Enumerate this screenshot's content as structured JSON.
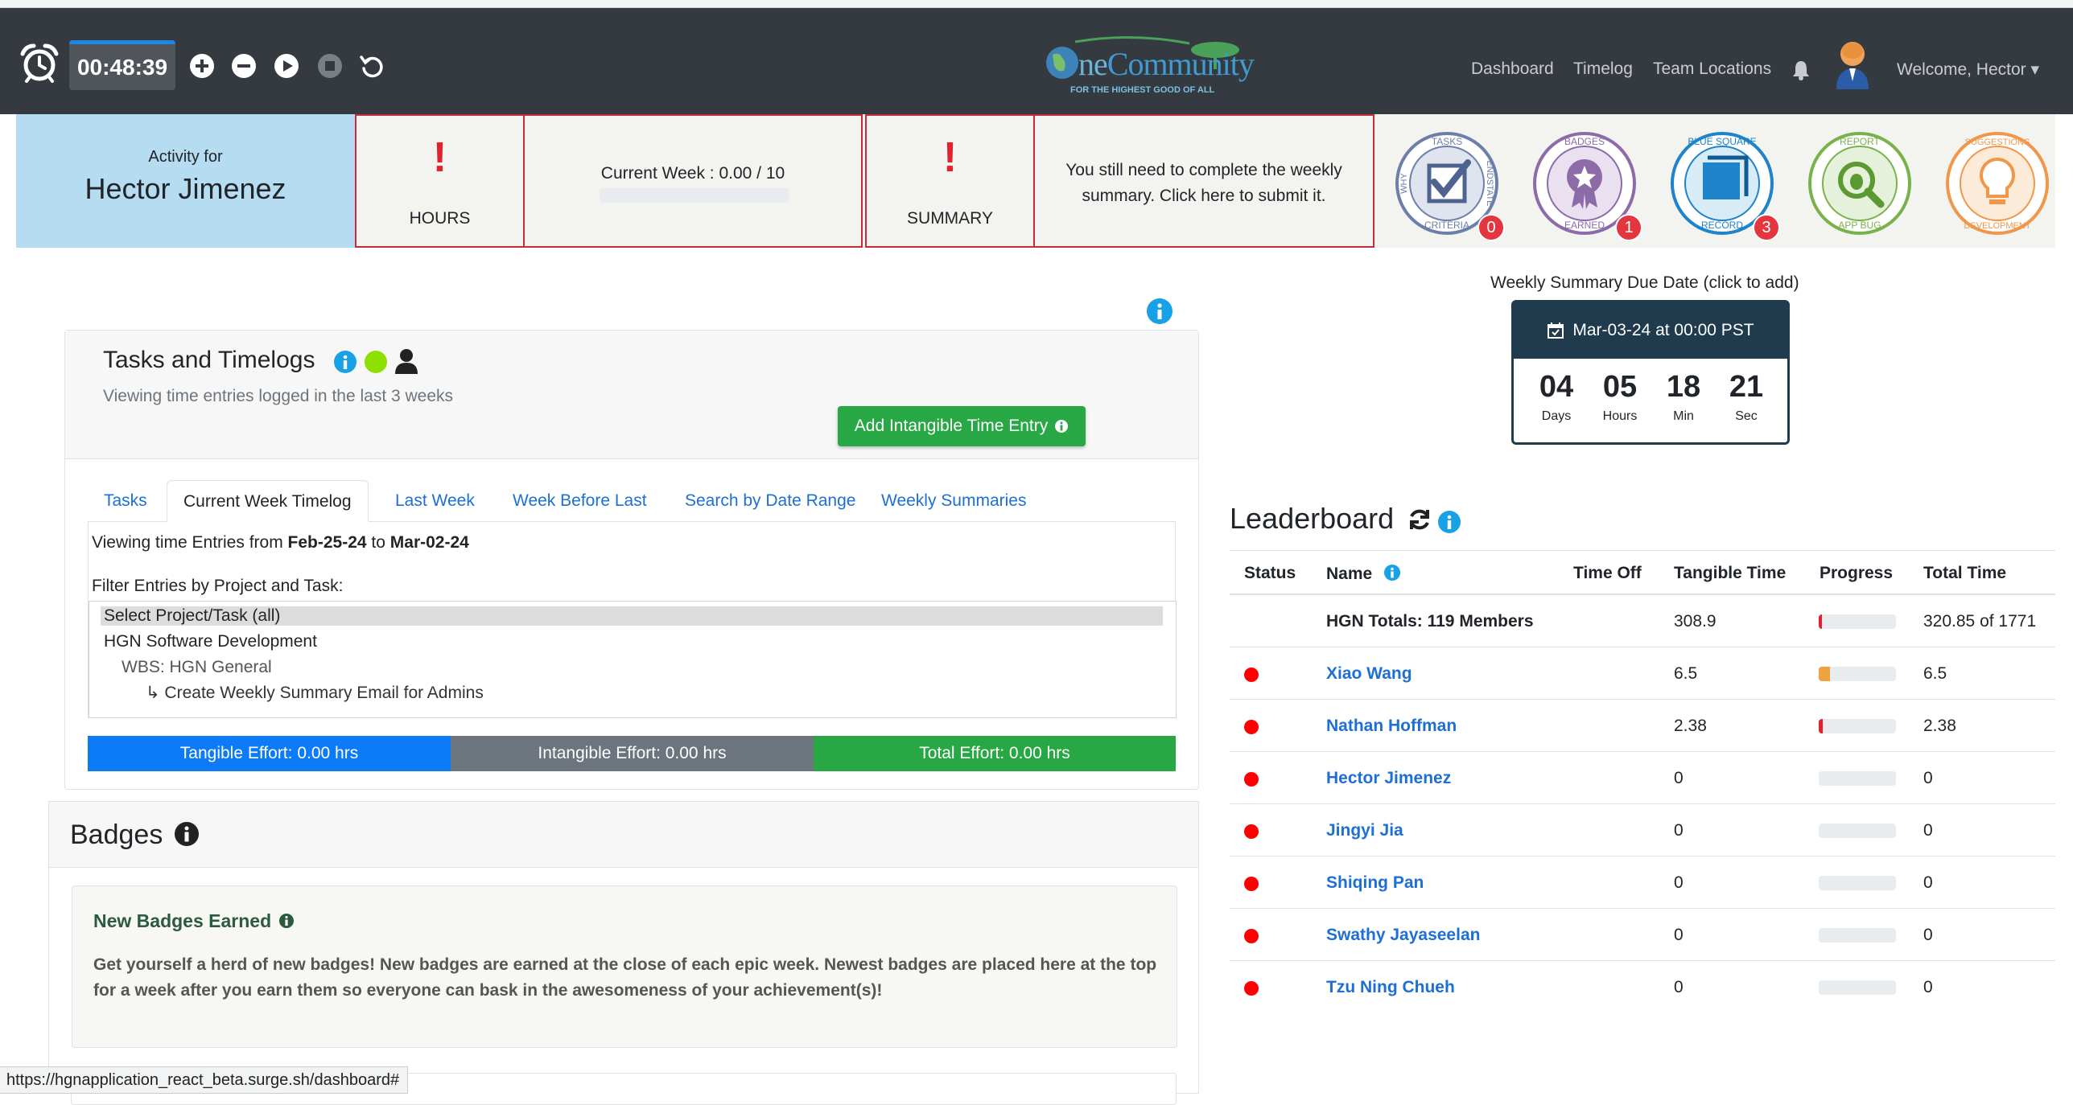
{
  "timer": {
    "display": "00:48:39"
  },
  "nav": {
    "links": [
      "Dashboard",
      "Timelog",
      "Team Locations"
    ],
    "welcome": "Welcome, Hector ▾"
  },
  "logo": {
    "text_main": "ne",
    "text_community": "Community",
    "tagline": "FOR THE HIGHEST GOOD OF ALL"
  },
  "summary": {
    "activity_label": "Activity for",
    "activity_name": "Hector Jimenez",
    "hours_label": "HOURS",
    "current_week": "Current Week : 0.00 / 10",
    "summary_label": "SUMMARY",
    "summary_text": "You still need to complete the weekly summary. Click here to submit it.",
    "bang": "!",
    "badges": [
      {
        "name": "tasks",
        "top": "TASKS",
        "bottom": "CRITERIA",
        "left": "WHY",
        "right": "ENDSTATE",
        "count": "0",
        "color": "#6c7fa8"
      },
      {
        "name": "badges",
        "top": "BADGES",
        "bottom": "EARNED",
        "count": "1",
        "color": "#8d6aa8"
      },
      {
        "name": "bluesquare",
        "top": "BLUE SQUARE",
        "bottom": "RECORD",
        "count": "3",
        "color": "#1f83c9"
      },
      {
        "name": "report",
        "top": "REPORT",
        "bottom": "APP BUG",
        "color": "#7ab24a"
      },
      {
        "name": "suggestions",
        "top": "SUGGESTIONS",
        "bottom": "DEVELOPMENT",
        "color": "#f0974a"
      }
    ]
  },
  "tasks": {
    "title": "Tasks and Timelogs",
    "subtitle": "Viewing time entries logged in the last 3 weeks",
    "add_button": "Add Intangible Time Entry",
    "tabs": [
      "Tasks",
      "Current Week Timelog",
      "Last Week",
      "Week Before Last",
      "Search by Date Range",
      "Weekly Summaries"
    ],
    "viewing_prefix": "Viewing time Entries from ",
    "viewing_from": "Feb-25-24",
    "viewing_to_word": " to ",
    "viewing_to": "Mar-02-24",
    "filter_label": "Filter Entries by Project and Task:",
    "options": [
      "Select Project/Task (all)",
      "HGN Software Development",
      "WBS: HGN General",
      "↳ Create Weekly Summary Email for Admins"
    ],
    "tangible": "Tangible Effort: 0.00 hrs",
    "intangible": "Intangible Effort: 0.00 hrs",
    "total": "Total Effort: 0.00 hrs"
  },
  "badges": {
    "title": "Badges",
    "new_title": "New Badges Earned",
    "new_text": "Get yourself a herd of new badges! New badges are earned at the close of each epic week. Newest badges are placed here at the top for a week after you earn them so everyone can bask in the awesomeness of your achievement(s)!"
  },
  "due": {
    "label": "Weekly Summary Due Date (click to add)",
    "date": "Mar-03-24 at 00:00 PST",
    "countdown": [
      {
        "num": "04",
        "lab": "Days"
      },
      {
        "num": "05",
        "lab": "Hours"
      },
      {
        "num": "18",
        "lab": "Min"
      },
      {
        "num": "21",
        "lab": "Sec"
      }
    ]
  },
  "leaderboard": {
    "title": "Leaderboard",
    "headers": [
      "Status",
      "Name",
      "Time Off",
      "Tangible Time",
      "Progress",
      "Total Time"
    ],
    "totals": {
      "name": "HGN Totals: 119 Members",
      "tangible": "308.9",
      "progress": 0.04,
      "total": "320.85 of 1771"
    },
    "rows": [
      {
        "name": "Xiao Wang",
        "tangible": "6.5",
        "progress": 0.15,
        "color": "#f0a140",
        "total": "6.5"
      },
      {
        "name": "Nathan Hoffman",
        "tangible": "2.38",
        "progress": 0.05,
        "color": "#e4222f",
        "total": "2.38"
      },
      {
        "name": "Hector Jimenez",
        "tangible": "0",
        "progress": 0,
        "color": "#e4222f",
        "total": "0"
      },
      {
        "name": "Jingyi Jia",
        "tangible": "0",
        "progress": 0,
        "color": "#e4222f",
        "total": "0"
      },
      {
        "name": "Shiqing Pan",
        "tangible": "0",
        "progress": 0,
        "color": "#e4222f",
        "total": "0"
      },
      {
        "name": "Swathy Jayaseelan",
        "tangible": "0",
        "progress": 0,
        "color": "#e4222f",
        "total": "0"
      },
      {
        "name": "Tzu Ning Chueh",
        "tangible": "0",
        "progress": 0,
        "color": "#e4222f",
        "total": "0"
      }
    ]
  },
  "status_url": "https://hgnapplication_react_beta.surge.sh/dashboard#"
}
